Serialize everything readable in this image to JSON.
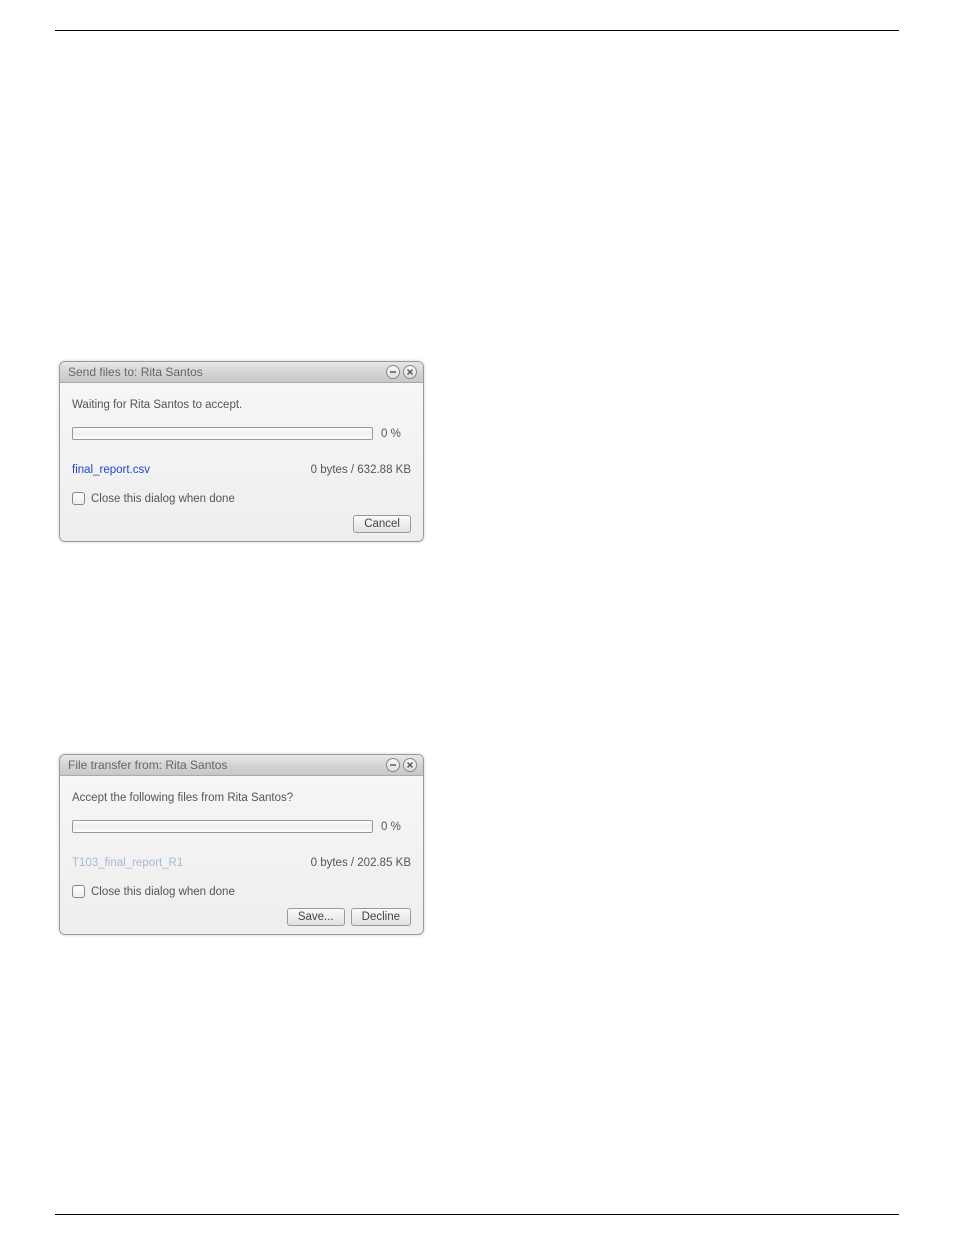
{
  "dialog_send": {
    "title": "Send files to: Rita Santos",
    "message": "Waiting for Rita Santos to accept.",
    "progress_pct": "0  %",
    "filename": "final_report.csv",
    "filesize": "0 bytes   /   632.88 KB",
    "close_label": "Close this dialog when done",
    "cancel": "Cancel"
  },
  "dialog_recv": {
    "title": "File transfer from: Rita Santos",
    "message": "Accept the following files from Rita Santos?",
    "progress_pct": "0  %",
    "filename": "T103_final_report_R1",
    "filesize": "0 bytes   /   202.85 KB",
    "close_label": "Close this dialog when done",
    "save": "Save...",
    "decline": "Decline"
  }
}
